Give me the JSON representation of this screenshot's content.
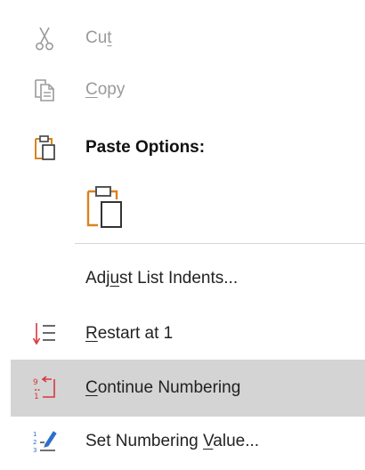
{
  "menu": {
    "cut": {
      "pre": "Cu",
      "u": "t",
      "post": ""
    },
    "copy": {
      "pre": "",
      "u": "C",
      "post": "opy"
    },
    "paste_options": {
      "label": "Paste Options:"
    },
    "adjust": {
      "pre": "Adj",
      "u": "u",
      "post": "st List Indents..."
    },
    "restart": {
      "pre": "",
      "u": "R",
      "post": "estart at 1"
    },
    "continue": {
      "pre": "",
      "u": "C",
      "post": "ontinue Numbering"
    },
    "set_value": {
      "pre": "Set Numbering ",
      "u": "V",
      "post": "alue..."
    }
  },
  "icons": {
    "cut": "scissors-icon",
    "copy": "copy-icon",
    "paste_options": "clipboard-icon",
    "paste_keep": "paste-keep-formatting-icon",
    "restart": "restart-numbering-icon",
    "continue": "continue-numbering-icon",
    "set_value": "set-numbering-value-icon"
  },
  "colors": {
    "disabled_text": "#9a9a9a",
    "text": "#222222",
    "highlight": "#d4d4d4",
    "accent_orange": "#d9831f",
    "accent_red": "#d9363e",
    "accent_blue": "#2f6fc6"
  }
}
